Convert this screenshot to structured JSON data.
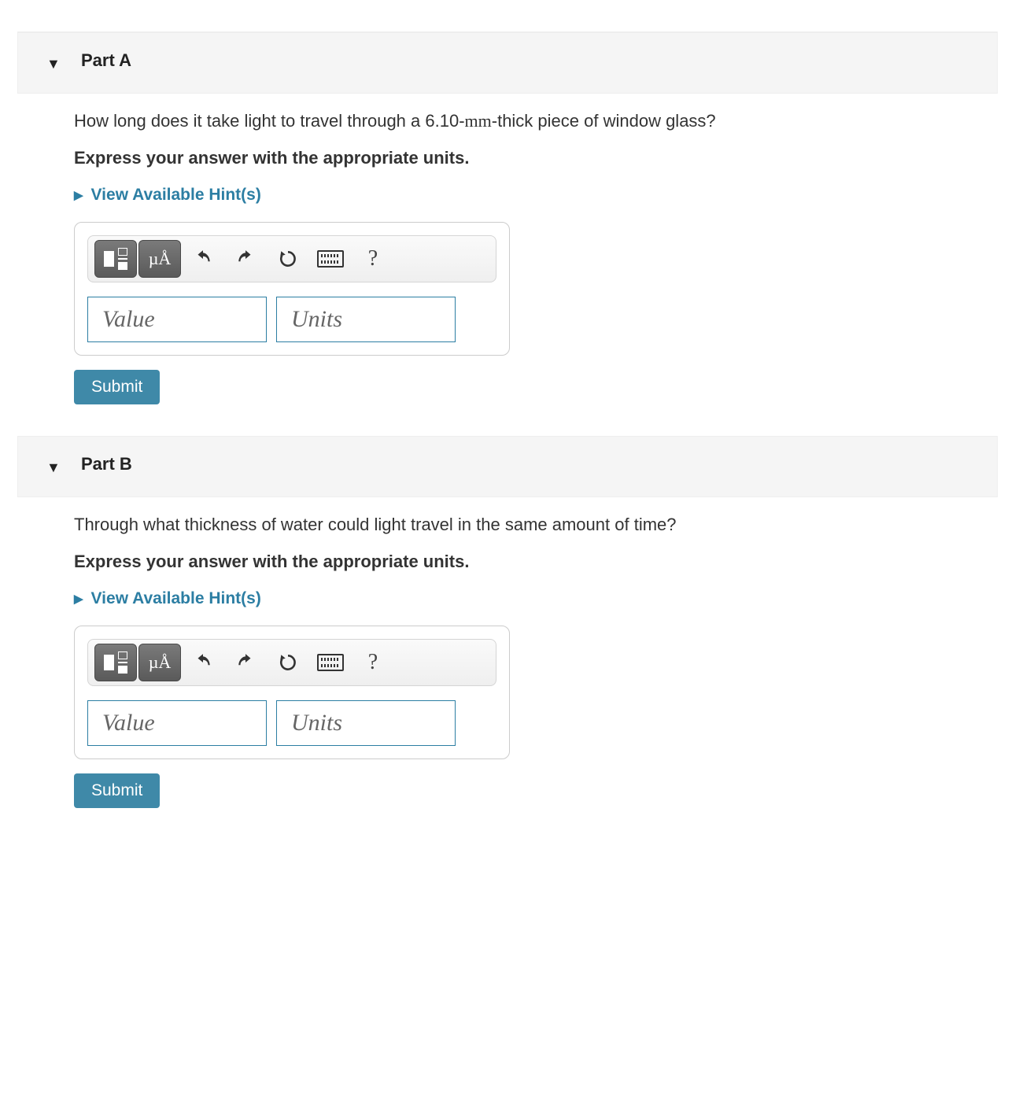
{
  "parts": [
    {
      "title": "Part A",
      "question_pre": "How long does it take light to travel through a 6.10-",
      "question_mm": "mm",
      "question_post": "-thick piece of window glass?",
      "instruction": "Express your answer with the appropriate units.",
      "hints_label": "View Available Hint(s)",
      "value_placeholder": "Value",
      "units_placeholder": "Units",
      "submit_label": "Submit"
    },
    {
      "title": "Part B",
      "question_pre": "Through what thickness of water could light travel in the same amount of time?",
      "question_mm": "",
      "question_post": "",
      "instruction": "Express your answer with the appropriate units.",
      "hints_label": "View Available Hint(s)",
      "value_placeholder": "Value",
      "units_placeholder": "Units",
      "submit_label": "Submit"
    }
  ],
  "toolbar": {
    "greek_label": "µÅ"
  }
}
